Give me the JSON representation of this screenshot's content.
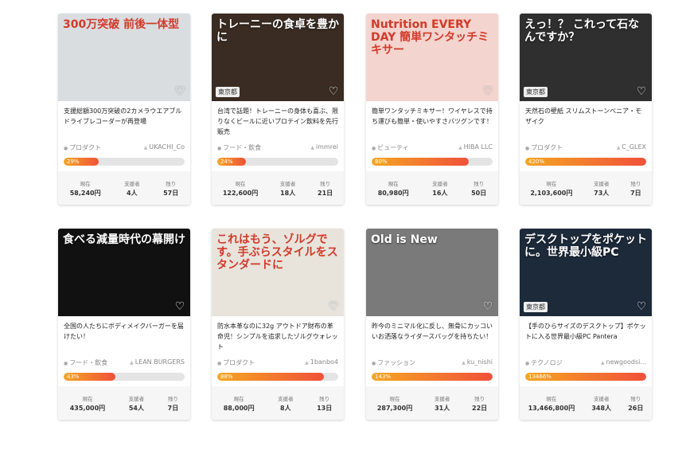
{
  "labels": {
    "current": "現在",
    "supporters": "支援者",
    "remaining": "残り"
  },
  "cards": [
    {
      "thumb_text": "300万突破 前後一体型",
      "location": "",
      "title": "支援総額300万突破の2カメラウエアブルドライブレコーダーが再登場",
      "category": "プロダクト",
      "owner": "UKACHI_Co",
      "percent_text": "29%",
      "percent": 29,
      "amount": "58,240円",
      "supporters": "4人",
      "days": "57日",
      "bg": "#d9dde0"
    },
    {
      "thumb_text": "トレーニーの食卓を豊かに",
      "location": "東京都",
      "title": "台湾で話題！トレーニーの身体も喜ぶ、限りなくビールに近いプロテイン飲料を先行販売",
      "category": "フード・飲食",
      "owner": "immrei",
      "percent_text": "24%",
      "percent": 24,
      "amount": "122,600円",
      "supporters": "18人",
      "days": "21日",
      "bg": "#3a2c22"
    },
    {
      "thumb_text": "Nutrition EVERY DAY 簡単ワンタッチミキサー",
      "location": "",
      "title": "簡単ワンタッチミキサー！ワイヤレスで持ち運びも簡単・使いやすさバツグンです！",
      "category": "ビューティ",
      "owner": "HIBA LLC",
      "percent_text": "80%",
      "percent": 80,
      "amount": "80,980円",
      "supporters": "16人",
      "days": "50日",
      "bg": "#f3d4cf"
    },
    {
      "thumb_text": "えっ！？ これって石なんですか？",
      "location": "東京都",
      "title": "天然石の壁紙 スリムストーンベニア・モザイク",
      "category": "プロダクト",
      "owner": "C_GLEX",
      "percent_text": "420%",
      "percent": 100,
      "amount": "2,103,600円",
      "supporters": "73人",
      "days": "7日",
      "bg": "#2f2f2f"
    },
    {
      "thumb_text": "食べる減量時代の幕開け",
      "location": "",
      "title": "全国の人たちにボディメイクバーガーを届けたい！",
      "category": "フード・飲食",
      "owner": "LEAN BURGERS",
      "percent_text": "43%",
      "percent": 43,
      "amount": "435,000円",
      "supporters": "54人",
      "days": "7日",
      "bg": "#111111"
    },
    {
      "thumb_text": "これはもう、ゾルグです。手ぶらスタイルをスタンダードに",
      "location": "",
      "title": "防水本革なのに32g アウトドア財布の革命児！シンプルを追求したゾルグウォレット",
      "category": "プロダクト",
      "owner": "1banbo4",
      "percent_text": "88%",
      "percent": 88,
      "amount": "88,000円",
      "supporters": "8人",
      "days": "13日",
      "bg": "#e8e4dc"
    },
    {
      "thumb_text": "Old is New",
      "location": "",
      "title": "昨今のミニマル化に反し、無骨にカッコいいお洒落なライダースバッグを持ちたい！",
      "category": "ファッション",
      "owner": "ku_nishi",
      "percent_text": "143%",
      "percent": 100,
      "amount": "287,300円",
      "supporters": "31人",
      "days": "22日",
      "bg": "#7a7a7a"
    },
    {
      "thumb_text": "デスクトップをポケットに。世界最小級PC",
      "location": "東京都",
      "title": "【手のひらサイズのデスクトップ】ポケットに入る世界最小級PC Pantera",
      "category": "テクノロジ",
      "owner": "newgoodsi...",
      "percent_text": "13466%",
      "percent": 100,
      "amount": "13,466,800円",
      "supporters": "348人",
      "days": "26日",
      "bg": "#1c2a3a"
    }
  ]
}
